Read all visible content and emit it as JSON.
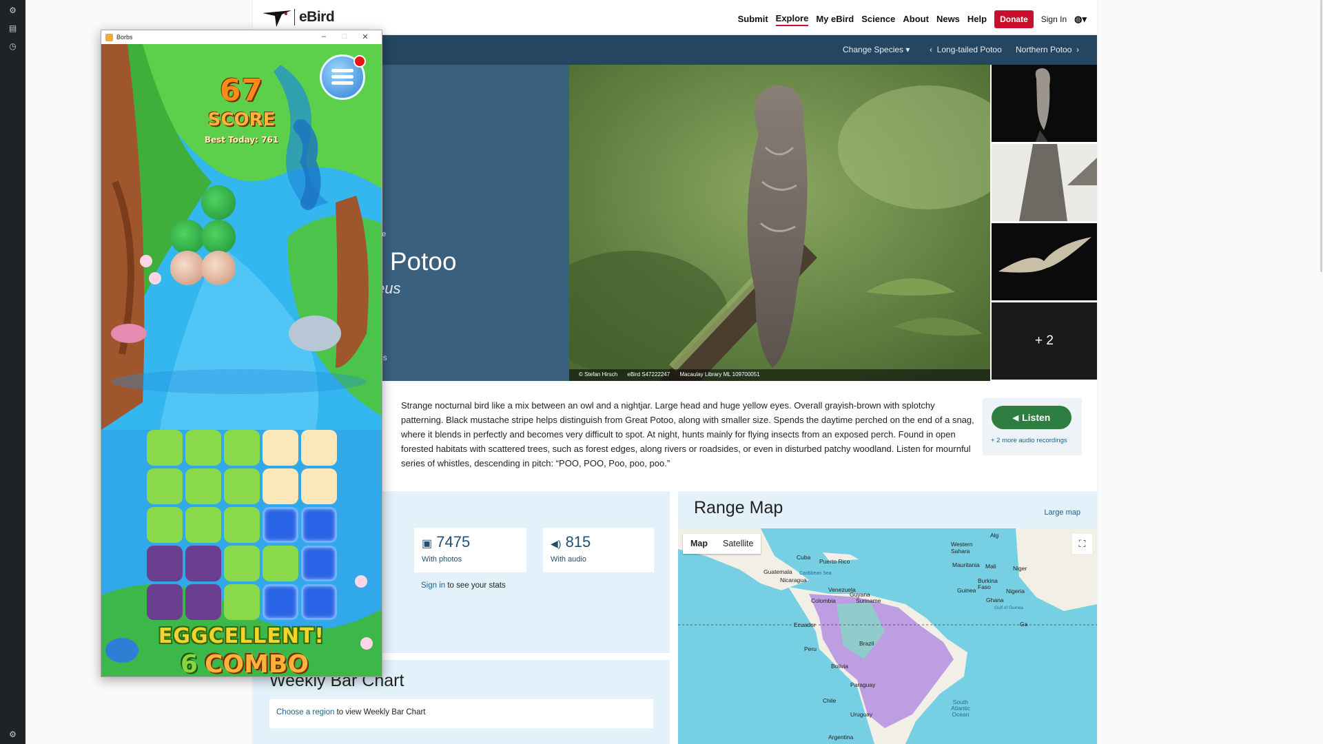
{
  "ebird": {
    "brand": "eBird",
    "nav": [
      "Submit",
      "Explore",
      "My eBird",
      "Science",
      "About",
      "News",
      "Help"
    ],
    "donate": "Donate",
    "sign_in": "Sign In",
    "subnav": {
      "change_species": "Change Species",
      "prev": "Long-tailed Potoo",
      "next": "Northern Potoo"
    },
    "hero": {
      "family": "ae",
      "common_name": "n Potoo",
      "sci_name": "seus",
      "more": "es"
    },
    "photo_credit": [
      "© Stefan Hirsch",
      "eBird S47222247",
      "Macaulay Library ML 109700051"
    ],
    "more_photos": "+ 2",
    "description": "Strange nocturnal bird like a mix between an owl and a nightjar. Large head and huge yellow eyes. Overall grayish-brown with splotchy patterning. Black mustache stripe helps distinguish from Great Potoo, along with smaller size. Spends the daytime perched on the end of a snag, where it blends in perfectly and becomes very difficult to spot. At night, hunts mainly for flying insects from an exposed perch. Found in open forested habitats with scattered trees, such as forest edges, along rivers or roadsides, or even in disturbed patchy woodland. Listen for mournful series of whistles, descending in pitch: “POO, POO, Poo, poo, poo.”",
    "listen": "Listen",
    "listen_more": "+ 2 more audio recordings",
    "stats": {
      "photos_num": "7475",
      "photos_lbl": "With photos",
      "audio_num": "815",
      "audio_lbl": "With audio",
      "sign_link": "Sign in",
      "sign_rest": " to see your stats"
    },
    "weekly": {
      "title": "Weekly Bar Chart",
      "link": "Choose a region",
      "rest": " to view Weekly Bar Chart"
    },
    "range": {
      "title": "Range Map",
      "large": "Large map",
      "tab_map": "Map",
      "tab_sat": "Satellite",
      "labels": [
        "Cuba",
        "Puerto Rico",
        "Guatemala",
        "Nicaragua",
        "Caribbean Sea",
        "Venezuela",
        "Guyana",
        "Suriname",
        "Colombia",
        "Ecuador",
        "Peru",
        "Brazil",
        "Bolivia",
        "Paraguay",
        "Chile",
        "Uruguay",
        "Argentina",
        "Western Sahara",
        "Mauritania",
        "Mali",
        "Niger",
        "Burkina Faso",
        "Guinea",
        "Ghana",
        "Nigeria",
        "Gulf of Guinea",
        "Alg",
        "Ga",
        "South Atlantic Ocean"
      ]
    }
  },
  "game": {
    "window_title": "Borbs",
    "score": "67",
    "score_label": "SCORE",
    "best": "Best Today: 761",
    "banner": "EGGCELLENT!",
    "combo_n": "6",
    "combo_word": "COMBO"
  }
}
